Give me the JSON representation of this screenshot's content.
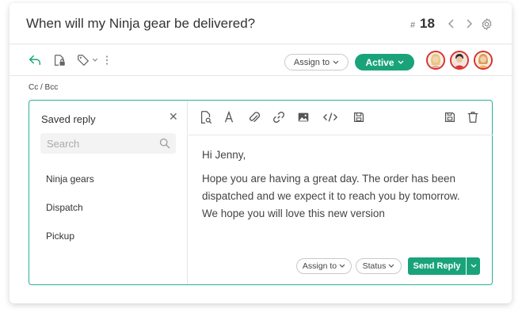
{
  "header": {
    "title": "When will my Ninja gear be delivered?",
    "ticket_hash": "#",
    "ticket_number": "18"
  },
  "toolbar": {
    "assign_label": "Assign to",
    "status_label": "Active"
  },
  "compose": {
    "cc_bcc": "Cc / Bcc"
  },
  "saved_reply": {
    "title": "Saved reply",
    "search_placeholder": "Search",
    "items": [
      {
        "label": "Ninja gears"
      },
      {
        "label": "Dispatch"
      },
      {
        "label": "Pickup"
      }
    ]
  },
  "message": {
    "greeting": "Hi Jenny,",
    "line1": "Hope you are having a great day. The order has been",
    "line2": "dispatched and we expect it to reach you by tomorrow.",
    "line3": "We hope you will love this new version"
  },
  "footer": {
    "assign_label": "Assign to",
    "status_label": "Status",
    "send_label": "Send Reply"
  },
  "colors": {
    "accent": "#1aa37a",
    "border_active": "#28b096",
    "avatar_ring": "#d93131"
  }
}
